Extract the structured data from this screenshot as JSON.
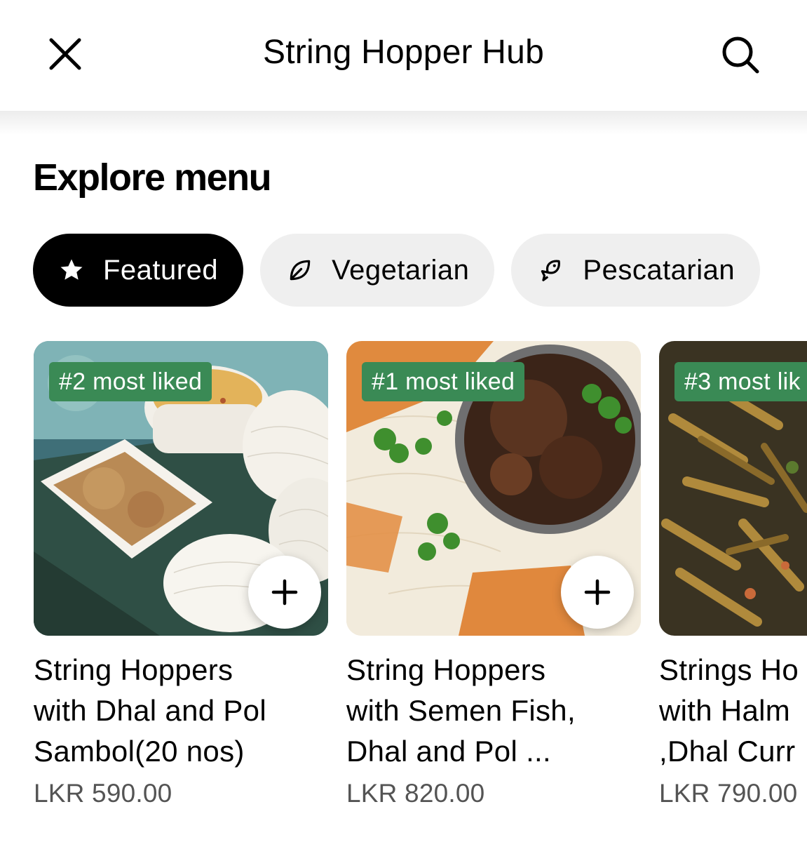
{
  "header": {
    "title": "String Hopper Hub",
    "close_icon": "close-icon",
    "search_icon": "search-icon"
  },
  "section": {
    "title": "Explore menu"
  },
  "filters": [
    {
      "label": "Featured",
      "icon": "star-icon",
      "active": true
    },
    {
      "label": "Vegetarian",
      "icon": "leaf-icon",
      "active": false
    },
    {
      "label": "Pescatarian",
      "icon": "fish-icon",
      "active": false
    }
  ],
  "items": [
    {
      "badge": "#2 most liked",
      "name_lines": [
        "String Hoppers",
        "with Dhal and Pol",
        "Sambol(20 nos)"
      ],
      "price": "LKR 590.00",
      "add_icon": "plus-icon"
    },
    {
      "badge": "#1 most liked",
      "name_lines": [
        "String Hoppers",
        "with Semen Fish,",
        "Dhal and Pol ..."
      ],
      "price": "LKR 820.00",
      "add_icon": "plus-icon"
    },
    {
      "badge": "#3 most lik",
      "name_lines": [
        "Strings Ho",
        "with Halm",
        ",Dhal Curr"
      ],
      "price": "LKR 790.00",
      "add_icon": "plus-icon"
    }
  ],
  "colors": {
    "badge": "#3a8a55",
    "chip_active": "#000000",
    "chip_inactive": "#efefef",
    "price_text": "#545454"
  }
}
